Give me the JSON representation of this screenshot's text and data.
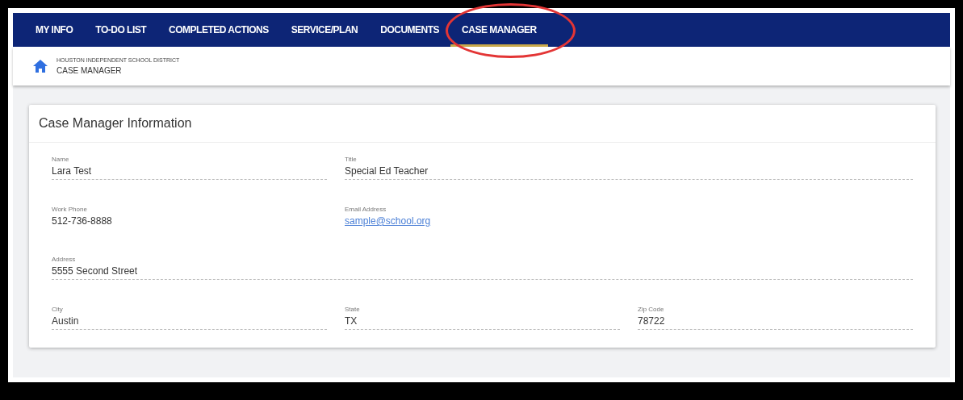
{
  "tabs": [
    {
      "label": "MY INFO",
      "selected": false,
      "circled": false
    },
    {
      "label": "TO-DO LIST",
      "selected": false,
      "circled": false
    },
    {
      "label": "COMPLETED ACTIONS",
      "selected": false,
      "circled": false
    },
    {
      "label": "SERVICE/PLAN",
      "selected": false,
      "circled": false
    },
    {
      "label": "DOCUMENTS",
      "selected": false,
      "circled": false
    },
    {
      "label": "CASE MANAGER",
      "selected": true,
      "circled": true
    }
  ],
  "breadcrumb": {
    "district": "HOUSTON INDEPENDENT SCHOOL DISTRICT",
    "page": "CASE MANAGER"
  },
  "card": {
    "title": "Case Manager Information",
    "rows": [
      [
        {
          "label": "Name",
          "value": "Lara Test",
          "kind": "text"
        },
        {
          "label": "Title",
          "value": "Special Ed Teacher",
          "kind": "text"
        }
      ],
      [
        {
          "label": "Work Phone",
          "value": "512-736-8888",
          "kind": "plain"
        },
        {
          "label": "Email Address",
          "value": "sample@school.org",
          "kind": "link"
        }
      ],
      [
        {
          "label": "Address",
          "value": "5555 Second Street",
          "kind": "text"
        }
      ],
      [
        {
          "label": "City",
          "value": "Austin",
          "kind": "text"
        },
        {
          "label": "State",
          "value": "TX",
          "kind": "text"
        },
        {
          "label": "Zip Code",
          "value": "78722",
          "kind": "text"
        }
      ]
    ]
  }
}
